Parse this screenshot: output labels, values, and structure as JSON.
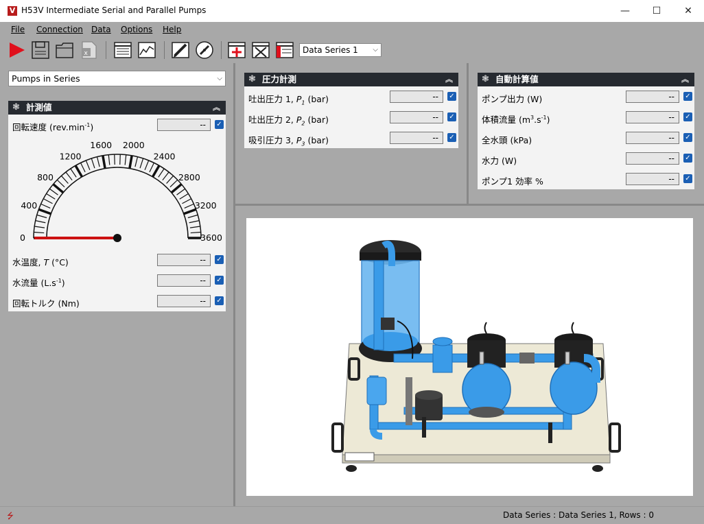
{
  "window": {
    "title": "H53V Intermediate Serial and Parallel Pumps",
    "app_icon_letter": "V",
    "minimize": "—",
    "maximize": "☐",
    "close": "✕"
  },
  "menu": [
    "File",
    "Connection",
    "Data",
    "Options",
    "Help"
  ],
  "toolbar": {
    "data_series_select": "Data Series 1"
  },
  "config_select": "Pumps in Series",
  "measurements_panel": {
    "title": "計測値",
    "speed_label": "回転速度",
    "speed_unit": "(rev.min",
    "speed_unit_sup": "-1",
    "speed_unit_end": ")",
    "speed_value": "--",
    "gauge": {
      "min": 0,
      "max": 3600,
      "value": 0,
      "tick_labels": [
        "0",
        "400",
        "800",
        "1200",
        "1600",
        "2000",
        "2400",
        "2800",
        "3200",
        "3600"
      ]
    },
    "rows": [
      {
        "label": "水温度, ",
        "italic": "T",
        "unit": " (°C)",
        "value": "--"
      },
      {
        "label": "水流量 ",
        "unit": "(L.s",
        "sup": "-1",
        "unit_end": ")",
        "value": "--"
      },
      {
        "label": "回転トルク ",
        "unit": "(Nm)",
        "value": "--"
      }
    ]
  },
  "pressure_panel": {
    "title": "圧力計測",
    "rows": [
      {
        "label": "吐出圧力 1, ",
        "sym": "P",
        "sub": "1",
        "unit": " (bar)",
        "value": "--"
      },
      {
        "label": "吐出圧力 2, ",
        "sym": "P",
        "sub": "2",
        "unit": " (bar)",
        "value": "--"
      },
      {
        "label": "吸引圧力 3, ",
        "sym": "P",
        "sub": "3",
        "unit": " (bar)",
        "value": "--"
      }
    ]
  },
  "calc_panel": {
    "title": "自動計算値",
    "rows": [
      {
        "label": "ポンプ出力 ",
        "unit": "(W)",
        "value": "--"
      },
      {
        "label": "体積流量 ",
        "unit": "(m",
        "sup": "3",
        "unit_mid": ".s",
        "sup2": "-1",
        "unit_end": ")",
        "value": "--"
      },
      {
        "label": "全水頭 ",
        "unit": "(kPa)",
        "value": "--"
      },
      {
        "label": "水力 ",
        "unit": "(W)",
        "value": "--"
      },
      {
        "label": "ポンプ1  効率 %",
        "unit": "",
        "value": "--"
      }
    ]
  },
  "status": {
    "text": "Data Series : Data Series 1,  Rows : 0"
  },
  "colors": {
    "panel_header": "#262a30",
    "checkbox": "#1b5fb4",
    "needle": "#cc1111",
    "water": "#3a9be8"
  }
}
